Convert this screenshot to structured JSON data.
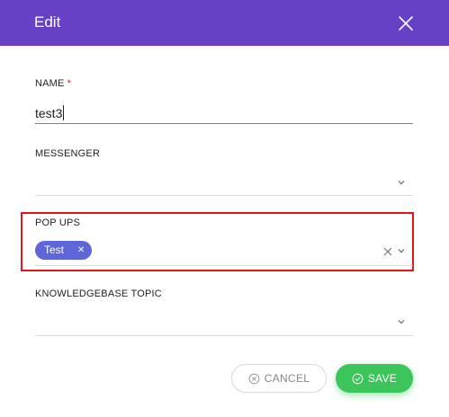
{
  "dialog": {
    "title": "Edit"
  },
  "fields": {
    "name": {
      "label": "NAME",
      "required_marker": "*",
      "value": "test3"
    },
    "messenger": {
      "label": "MESSENGER",
      "value": ""
    },
    "popups": {
      "label": "POP UPS",
      "selected": [
        "Test"
      ]
    },
    "knowledgebase_topic": {
      "label": "KNOWLEDGEBASE TOPIC",
      "value": ""
    }
  },
  "buttons": {
    "cancel": "CANCEL",
    "save": "SAVE"
  },
  "colors": {
    "header": "#6741c5",
    "chip": "#5f67d8",
    "save": "#3cc55b",
    "highlight": "#e5141a"
  }
}
